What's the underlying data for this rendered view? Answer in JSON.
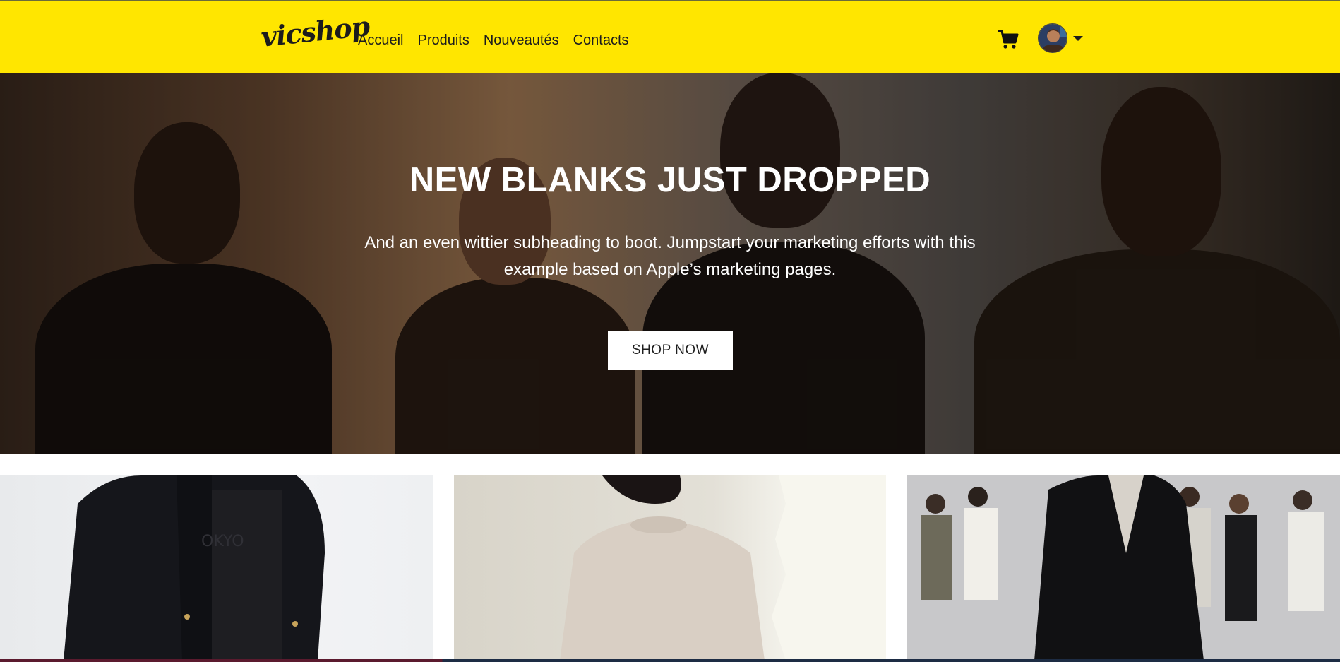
{
  "app": {
    "brand": "vicshop"
  },
  "nav": {
    "links": [
      "Accueil",
      "Produits",
      "Nouveautés",
      "Contacts"
    ],
    "cart_icon": "shopping-cart-icon",
    "avatar_icon": "user-avatar"
  },
  "hero": {
    "title": "NEW BLANKS JUST DROPPED",
    "subtitle": "And an even wittier subheading to boot. Jumpstart your marketing efforts with this example based on Apple’s marketing pages.",
    "button_label": "SHOP NOW"
  },
  "colors": {
    "navbar_bg": "#ffe600",
    "hero_text": "#ffffff",
    "button_bg": "#ffffff"
  }
}
